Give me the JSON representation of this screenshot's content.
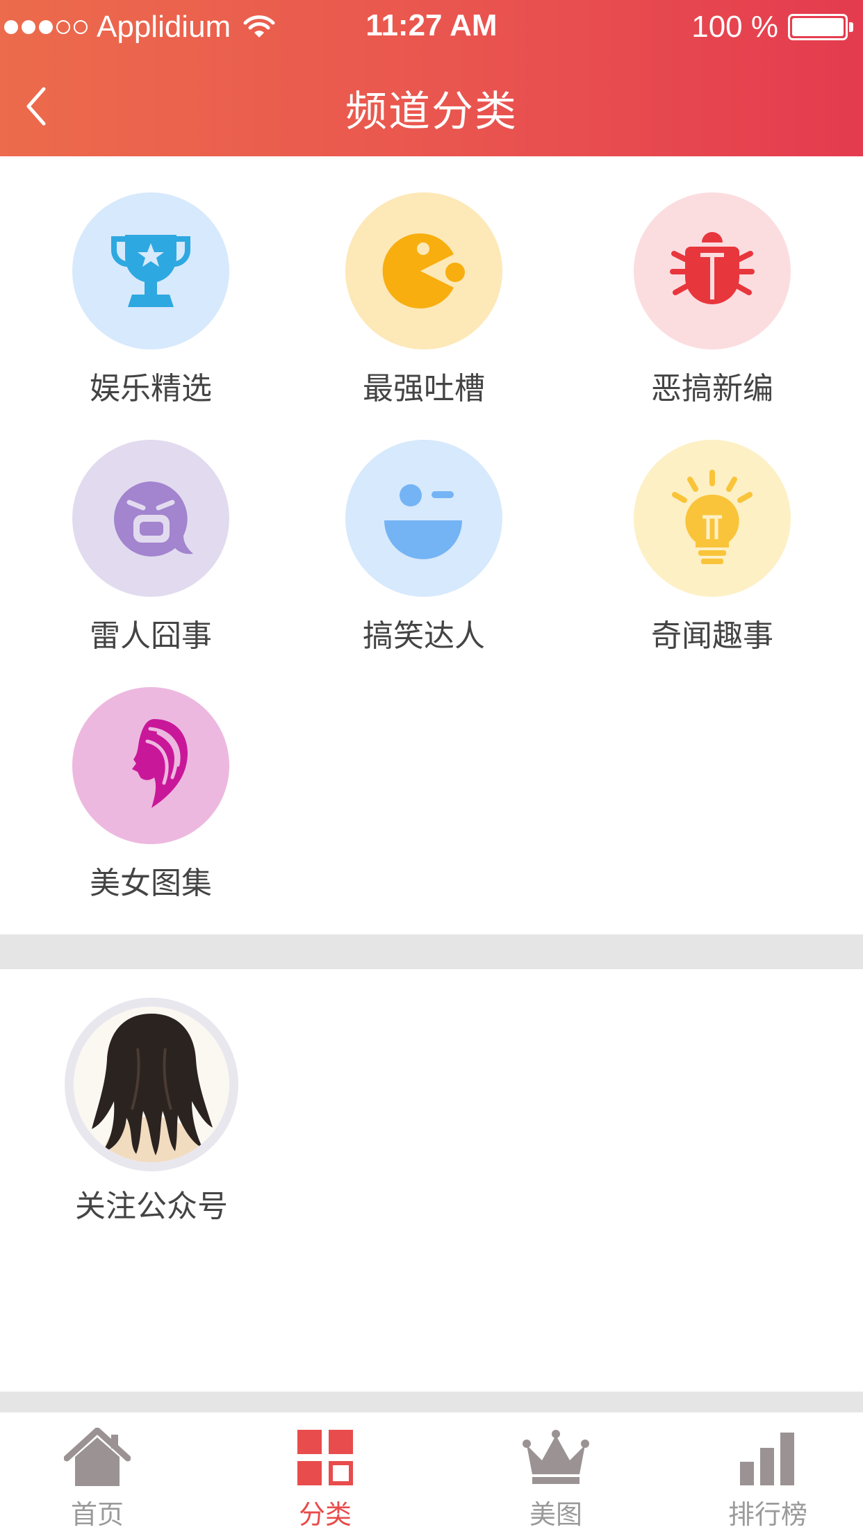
{
  "status_bar": {
    "carrier": "Applidium",
    "time": "11:27 AM",
    "battery": "100 %"
  },
  "nav": {
    "title": "频道分类",
    "back_icon": "chevron-left-icon"
  },
  "categories": [
    {
      "label": "娱乐精选",
      "icon": "trophy-icon",
      "bg": "#d7e9fc",
      "fg": "#2ea8e0"
    },
    {
      "label": "最强吐槽",
      "icon": "pacman-icon",
      "bg": "#fde8b7",
      "fg": "#f7ae0e"
    },
    {
      "label": "恶搞新编",
      "icon": "bug-icon",
      "bg": "#fbdde0",
      "fg": "#e8363d"
    },
    {
      "label": "雷人囧事",
      "icon": "crying-bubble-icon",
      "bg": "#e2dbef",
      "fg": "#a284cf"
    },
    {
      "label": "搞笑达人",
      "icon": "wink-face-icon",
      "bg": "#d7e9fc",
      "fg": "#74b4f5"
    },
    {
      "label": "奇闻趣事",
      "icon": "lightbulb-icon",
      "bg": "#fdf0c5",
      "fg": "#f9c43a"
    },
    {
      "label": "美女图集",
      "icon": "woman-profile-icon",
      "bg": "#edb8df",
      "fg": "#c9179a"
    }
  ],
  "follow": {
    "label": "关注公众号",
    "icon": "avatar-icon"
  },
  "tabs": [
    {
      "label": "首页",
      "icon": "home-icon",
      "active": false
    },
    {
      "label": "分类",
      "icon": "grid-icon",
      "active": true
    },
    {
      "label": "美图",
      "icon": "crown-icon",
      "active": false
    },
    {
      "label": "排行榜",
      "icon": "bar-chart-icon",
      "active": false
    }
  ],
  "colors": {
    "header_start": "#ec6b4c",
    "header_end": "#e43b4f",
    "tab_active": "#e84c4c",
    "tab_inactive": "#9a9a9a"
  }
}
